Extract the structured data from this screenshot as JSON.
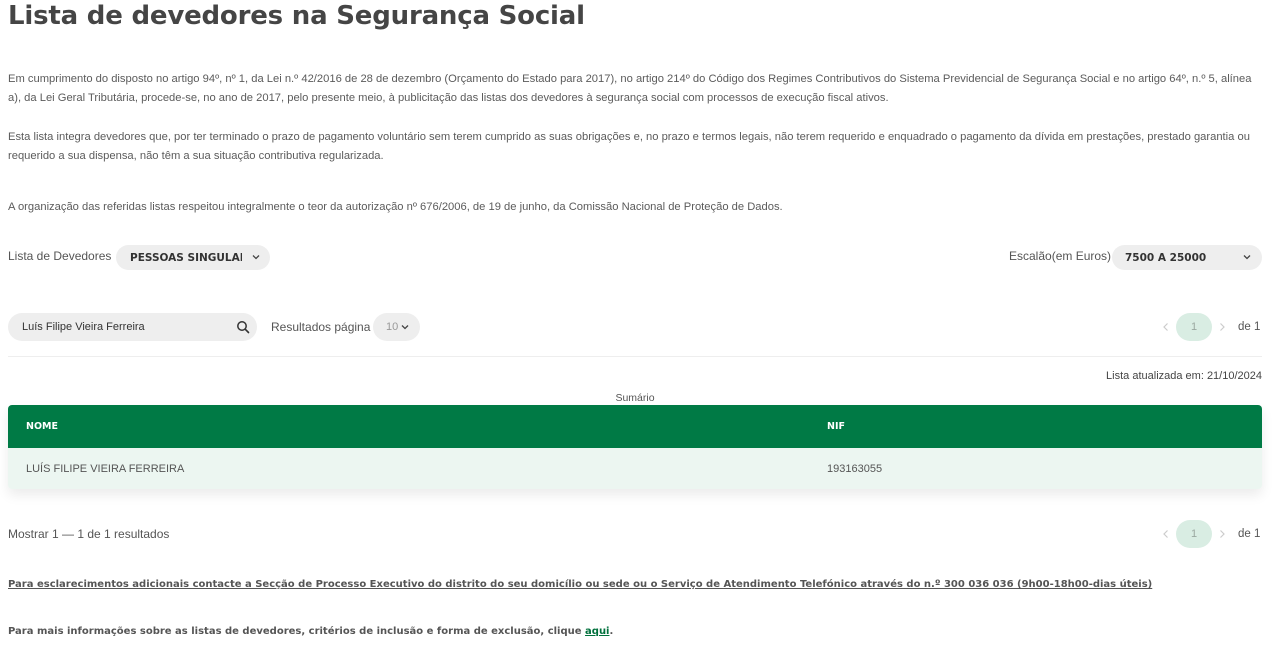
{
  "page": {
    "title": "Lista de devedores na Segurança Social",
    "paragraphs": [
      "Em cumprimento do disposto no artigo 94º, nº 1, da Lei n.º 42/2016 de 28 de dezembro (Orçamento do Estado para 2017), no artigo 214º do Código dos Regimes Contributivos do Sistema Previdencial de Segurança Social e no artigo 64º, n.º 5, alínea a), da Lei Geral Tributária, procede-se, no ano de 2017, pelo presente meio, à publicitação das listas dos devedores à segurança social com processos de execução fiscal ativos.",
      "Esta lista integra devedores que, por ter terminado o prazo de pagamento voluntário sem terem cumprido as suas obrigações e, no prazo e termos legais, não terem requerido e enquadrado o pagamento da dívida em prestações, prestado garantia ou requerido a sua dispensa, não têm a sua situação contributiva regularizada.",
      "A organização das referidas listas respeitou integralmente o teor da autorização nº 676/2006, de 19 de junho, da Comissão Nacional de Proteção de Dados."
    ]
  },
  "filters": {
    "list_label": "Lista de Devedores",
    "list_value": "PESSOAS SINGULARES",
    "bracket_label": "Escalão(em Euros)",
    "bracket_value": "7500 A 25000"
  },
  "search": {
    "value": "Luís Filipe Vieira Ferreira",
    "results_label": "Resultados página",
    "page_size": "10"
  },
  "pagination": {
    "current": "1",
    "of_text": "de 1"
  },
  "table": {
    "updated": "Lista atualizada em: 21/10/2024",
    "caption": "Sumário",
    "headers": [
      "NOME",
      "NIF"
    ],
    "rows": [
      [
        "LUÍS FILIPE VIEIRA FERREIRA",
        "193163055"
      ]
    ]
  },
  "results_text": "Mostrar 1 — 1 de 1 resultados",
  "footer": {
    "contact": "Para esclarecimentos adicionais contacte a Secção de Processo Executivo do distrito do seu domicílio ou sede ou o Serviço de Atendimento Telefónico através do n.º 300 036 036 (9h00-18h00-dias úteis)",
    "more_info": "Para mais informações sobre as listas de devedores, critérios de inclusão e forma de exclusão, clique ",
    "link": "aqui",
    "period": "."
  },
  "icons": {
    "search": "search-icon",
    "dropdown": "chevron-down-icon",
    "prev": "chevron-left-icon",
    "next": "chevron-right-icon"
  },
  "colors": {
    "header_green": "#007a45",
    "row_bg": "#ecf6f1",
    "page_active": "#d9ede3",
    "link": "#00703c"
  }
}
